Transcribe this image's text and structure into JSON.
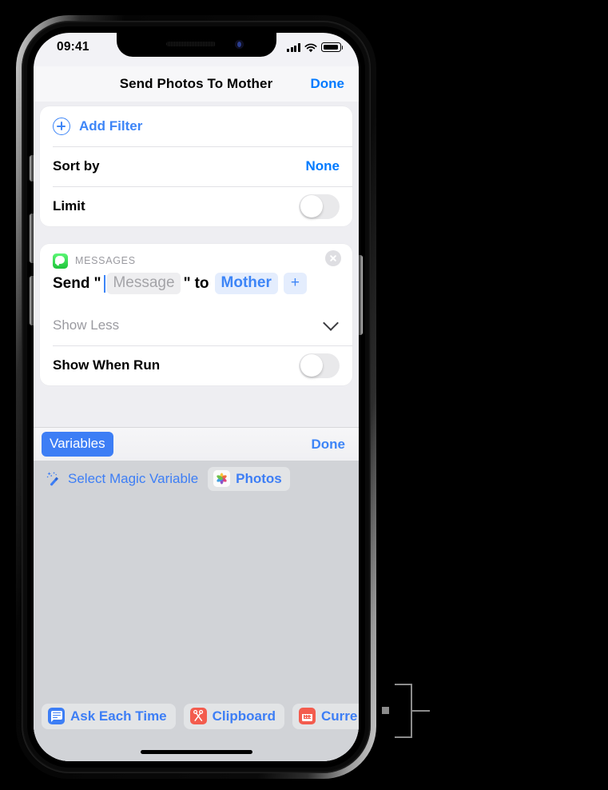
{
  "status_bar": {
    "time": "09:41",
    "icons": [
      "cellular-signal-icon",
      "wifi-icon",
      "battery-icon"
    ]
  },
  "nav_bar": {
    "title": "Send Photos To Mother",
    "done_label": "Done"
  },
  "filter_card": {
    "add_filter_label": "Add Filter",
    "add_filter_icon": "plus-circle-icon",
    "sort_by_label": "Sort by",
    "sort_by_value": "None",
    "limit_label": "Limit",
    "limit_toggle_state": "off"
  },
  "action_card": {
    "app_name": "MESSAGES",
    "app_icon": "messages-icon",
    "close_icon": "close-circle-icon",
    "sentence": {
      "verb": "Send",
      "open_quote": "\"",
      "message_placeholder": "Message",
      "close_quote": "\"",
      "preposition": "to",
      "recipient": "Mother",
      "add_recipient": "+"
    },
    "show_less_label": "Show Less",
    "show_less_icon": "chevron-down-icon",
    "show_when_run_label": "Show When Run",
    "show_when_run_toggle_state": "off"
  },
  "accessory_bar": {
    "variables_label": "Variables",
    "done_label": "Done"
  },
  "magic_variable_row": {
    "wand_icon": "magic-wand-icon",
    "label": "Select Magic Variable",
    "chip": {
      "icon": "photos-icon",
      "label": "Photos"
    }
  },
  "variable_chips": [
    {
      "icon": "ask-each-time-icon",
      "label": "Ask Each Time",
      "color": "#3d7ef5"
    },
    {
      "icon": "scissors-icon",
      "label": "Clipboard",
      "color": "#f35c4e"
    },
    {
      "icon": "calendar-icon",
      "label": "Curre",
      "color": "#f35c4e"
    }
  ],
  "colors": {
    "accent_blue": "#3d85f7",
    "link_blue": "#007aff",
    "variables_button": "#3d7ef5",
    "keyboard_background": "#d1d3d7",
    "card_background": "#ffffff",
    "content_background": "#eeeef2",
    "messages_green": "#1fc43a",
    "chip_red": "#f35c4e",
    "callout_gray": "#8c8c8c"
  }
}
